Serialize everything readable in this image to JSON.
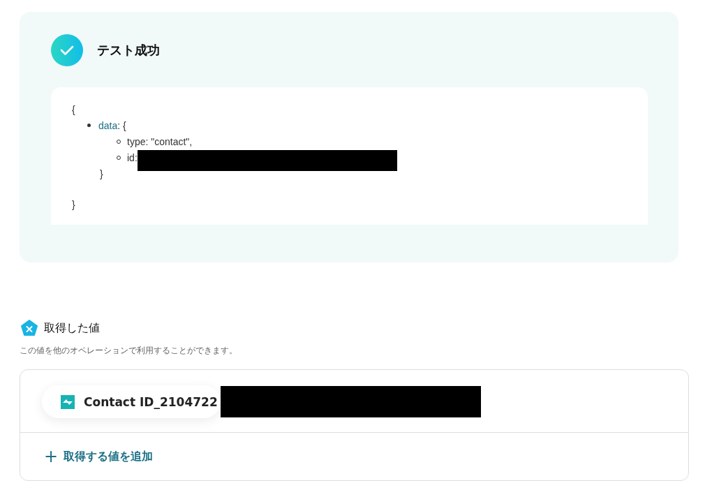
{
  "test_result": {
    "title": "テスト成功",
    "success": true,
    "code": {
      "open": "{",
      "items": [
        {
          "key": "data",
          "rest": ": {",
          "children": [
            "type: \"contact\",",
            "id:"
          ],
          "close": "}"
        }
      ],
      "close": "}"
    }
  },
  "values_section": {
    "title": "取得した値",
    "description": "この値を他のオペレーションで利用することができます。",
    "values": [
      {
        "label": "Contact ID_2104722"
      }
    ],
    "add_button": {
      "icon": "+",
      "label": "取得する値を追加"
    }
  }
}
